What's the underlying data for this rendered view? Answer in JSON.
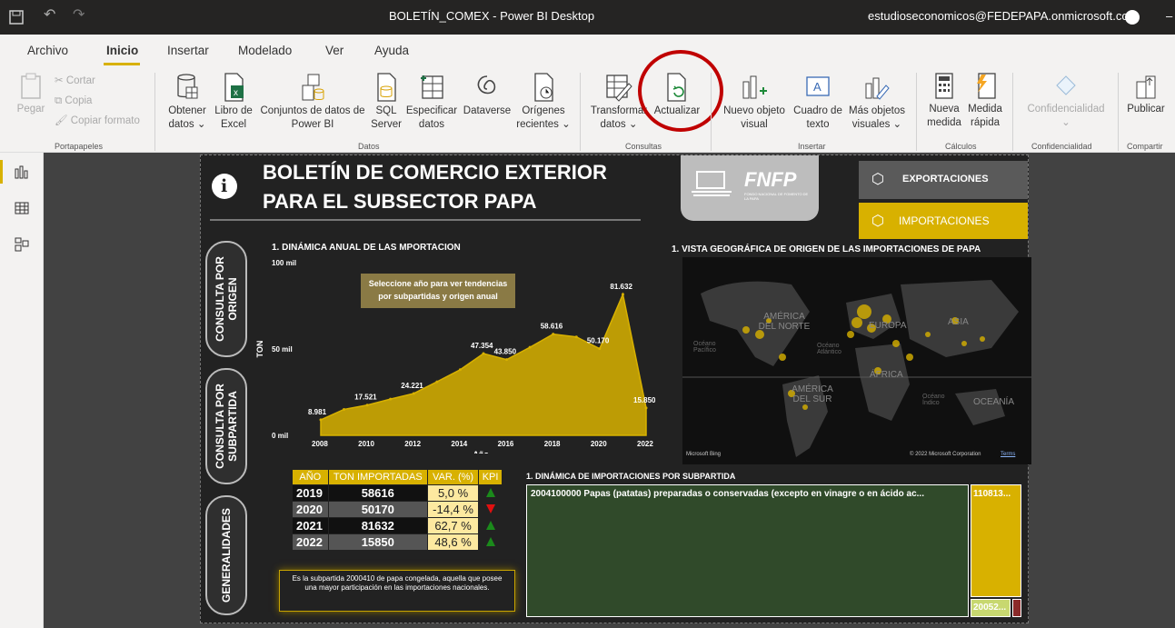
{
  "window": {
    "title": "BOLETÍN_COMEX - Power BI Desktop",
    "account": "estudioseconomicos@FEDEPAPA.onmicrosoft.com"
  },
  "menu": [
    "Archivo",
    "Inicio",
    "Insertar",
    "Modelado",
    "Ver",
    "Ayuda"
  ],
  "ribbon": {
    "clipboard": {
      "pegar": "Pegar",
      "cortar": "Cortar",
      "copia": "Copia",
      "copiar_formato": "Copiar formato",
      "group": "Portapapeles"
    },
    "datos": {
      "obtener_1": "Obtener",
      "obtener_2": "datos ⌄",
      "libro_1": "Libro de",
      "libro_2": "Excel",
      "conjuntos_1": "Conjuntos de datos de",
      "conjuntos_2": "Power BI",
      "sql_1": "SQL",
      "sql_2": "Server",
      "especificar_1": "Especificar",
      "especificar_2": "datos",
      "dataverse": "Dataverse",
      "origenes_1": "Orígenes",
      "origenes_2": "recientes ⌄",
      "group": "Datos"
    },
    "consultas": {
      "transformar_1": "Transformar",
      "transformar_2": "datos ⌄",
      "actualizar": "Actualizar",
      "group": "Consultas"
    },
    "insertar": {
      "nuevo_1": "Nuevo objeto",
      "nuevo_2": "visual",
      "cuadro_1": "Cuadro de",
      "cuadro_2": "texto",
      "mas_1": "Más objetos",
      "mas_2": "visuales ⌄",
      "group": "Insertar"
    },
    "calculos": {
      "nueva_1": "Nueva",
      "nueva_2": "medida",
      "medida_1": "Medida",
      "medida_2": "rápida",
      "group": "Cálculos"
    },
    "confidencialidad": {
      "label": "Confidencialidad",
      "arrow": "⌄",
      "group": "Confidencialidad"
    },
    "compartir": {
      "publicar": "Publicar",
      "group": "Compartir"
    }
  },
  "report": {
    "title_line1": "BOLETÍN DE COMERCIO EXTERIOR",
    "title_line2": "PARA EL SUBSECTOR PAPA",
    "logo_text": "FNFP",
    "logo_sub": "FONDO NACIONAL DE FOMENTO DE LA PAPA",
    "btn_export": "EXPORTACIONES",
    "btn_import": "IMPORTACIONES",
    "tab_origen": "CONSULTA POR ORIGEN",
    "tab_subpartida": "CONSULTA POR SUBPARTIDA",
    "tab_generalidades": "GENERALIDADES",
    "chart_title": "1. DINÁMICA ANUAL DE LAS MPORTACION",
    "tooltip": "Seleccione año para ver tendencias por subpartidas y origen anual",
    "map_title": "1. VISTA GEOGRÁFICA DE ORIGEN DE LAS IMPORTACIONES DE PAPA",
    "map_labels": {
      "america_norte": "AMÉRICA DEL NORTE",
      "america_sur": "AMÉRICA DEL SUR",
      "europa": "EUROPA",
      "asia": "ASIA",
      "africa": "ÁFRICA",
      "oceania": "OCEANÍA",
      "pacifico": "Océano Pacífico",
      "atlantico": "Océano Atlántico",
      "indico": "Océano Índico"
    },
    "map_bing": "Microsoft Bing",
    "map_copy": "© 2022 Microsoft Corporation",
    "map_terms": "Terms",
    "treemap_title": "1. DINÁMICA DE IMPORTACIONES POR SUBPARTIDA",
    "treemap_main": "2004100000 Papas (patatas) preparadas o conservadas (excepto en vinagre o en ácido ac...",
    "treemap_v1": "110813...",
    "treemap_v2": "20052...",
    "note": "Es la subpartida 2000410 de papa congelada, aquella que posee una mayor participación en las importaciones nacionales.",
    "kpi_headers": [
      "AÑO",
      "TON IMPORTADAS",
      "VAR. (%)",
      "KPI"
    ],
    "kpi_rows": [
      {
        "year": "2019",
        "ton": "58616",
        "var": "5,0 %",
        "kpi": "up"
      },
      {
        "year": "2020",
        "ton": "50170",
        "var": "-14,4 %",
        "kpi": "down"
      },
      {
        "year": "2021",
        "ton": "81632",
        "var": "62,7 %",
        "kpi": "up"
      },
      {
        "year": "2022",
        "ton": "15850",
        "var": "48,6 %",
        "kpi": "up"
      }
    ]
  },
  "chart_data": {
    "type": "area",
    "title": "1. DINÁMICA ANUAL DE LAS MPORTACION",
    "xlabel": "Año",
    "ylabel": "TON",
    "x": [
      2008,
      2009,
      2010,
      2011,
      2012,
      2013,
      2014,
      2015,
      2016,
      2017,
      2018,
      2019,
      2020,
      2021,
      2022
    ],
    "y": [
      8981,
      15000,
      17521,
      21000,
      24221,
      31000,
      38000,
      47354,
      43850,
      51000,
      58616,
      57000,
      50170,
      81632,
      15850
    ],
    "point_labels": {
      "2008": "8.981",
      "2010": "17.521",
      "2012": "24.221",
      "2015": "47.354",
      "2016": "43.850",
      "2018": "58.616",
      "2020": "50.170",
      "2021": "81.632",
      "2022": "15.850"
    },
    "ytick_labels": [
      "0 mil",
      "50 mil",
      "100 mil"
    ],
    "yticks": [
      0,
      50000,
      100000
    ],
    "xticks": [
      2008,
      2010,
      2012,
      2014,
      2016,
      2018,
      2020,
      2022
    ],
    "ylim": [
      0,
      100000
    ],
    "color": "#d8b100"
  }
}
